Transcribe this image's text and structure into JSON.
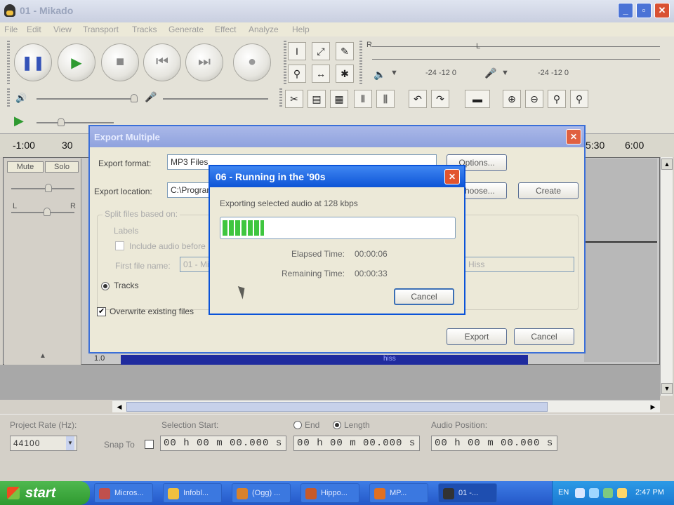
{
  "window": {
    "title": "01 - Mikado",
    "min_glyph": "_",
    "max_glyph": "▫",
    "close_glyph": "✕"
  },
  "menu": [
    "File",
    "Edit",
    "View",
    "Transport",
    "Tracks",
    "Generate",
    "Effect",
    "Analyze",
    "Help"
  ],
  "transport": {
    "pause": "❚❚",
    "play": "▶",
    "stop": "■",
    "skip_start": "⏮",
    "skip_end": "⏭",
    "record": "●"
  },
  "tools": {
    "selection": "I",
    "envelope": "⤢",
    "draw": "✎",
    "zoom": "⚲",
    "timeshift": "↔",
    "multi": "✱"
  },
  "meters": {
    "play_scale": "-24 -12 0",
    "record_scale": "-24 -12 0",
    "left": "L",
    "right": "R"
  },
  "ruler": {
    "ticks": [
      "-1:00",
      "30",
      "5:30",
      "6:00"
    ]
  },
  "track_panel": {
    "mute": "Mute",
    "solo": "Solo",
    "left_label": "L",
    "right_label": "R",
    "collapse": "▲"
  },
  "ruler_bottom": {
    "value": "1.0",
    "sel_text": "hiss"
  },
  "selection_bar": {
    "project_rate_label": "Project Rate (Hz):",
    "project_rate_value": "44100",
    "snap_to_label": "Snap To",
    "selection_start_label": "Selection Start:",
    "selection_start_value": "00 h 00 m 00.000 s",
    "end_label": "End",
    "length_label": "Length",
    "length_value": "00 h 00 m 00.000 s",
    "audio_position_label": "Audio Position:",
    "audio_position_value": "00 h 00 m 00.000 s"
  },
  "export_multiple": {
    "title": "Export Multiple",
    "format_label": "Export format:",
    "format_value": "MP3 Files",
    "options_button": "Options...",
    "location_label": "Export location:",
    "location_value": "C:\\Program",
    "choose_button": "Choose...",
    "create_button": "Create",
    "split_group_label": "Split files based on:",
    "labels_option": "Labels",
    "include_option": "Include audio before",
    "first_file_label": "First file name:",
    "first_file_value": "01 - Mi",
    "right_value": "Hiss",
    "tracks_option": "Tracks",
    "overwrite_label": "Overwrite existing files",
    "export_button": "Export",
    "cancel_button": "Cancel"
  },
  "progress": {
    "title": "06 - Running in the '90s",
    "message": "Exporting selected audio at 128 kbps",
    "percent": 18,
    "elapsed_label": "Elapsed Time:",
    "elapsed_value": "00:00:06",
    "remaining_label": "Remaining Time:",
    "remaining_value": "00:00:33",
    "cancel_button": "Cancel",
    "close_glyph": "✕"
  },
  "taskbar": {
    "start_label": "start",
    "tasks": [
      {
        "label": "Micros...",
        "color": "#c0504d"
      },
      {
        "label": "Infobl...",
        "color": "#f0c040"
      },
      {
        "label": "(Ogg) ...",
        "color": "#d9822b"
      },
      {
        "label": "Hippo...",
        "color": "#c75a2a"
      },
      {
        "label": "MP...",
        "color": "#e07020"
      },
      {
        "label": "01 -...",
        "color": "#333333"
      }
    ],
    "lang": "EN",
    "time": "2:47 PM"
  },
  "colors": {
    "xp_blue": "#0a53d9",
    "progress_green": "#3fc63f",
    "selection_blue": "#1f2b9e"
  }
}
